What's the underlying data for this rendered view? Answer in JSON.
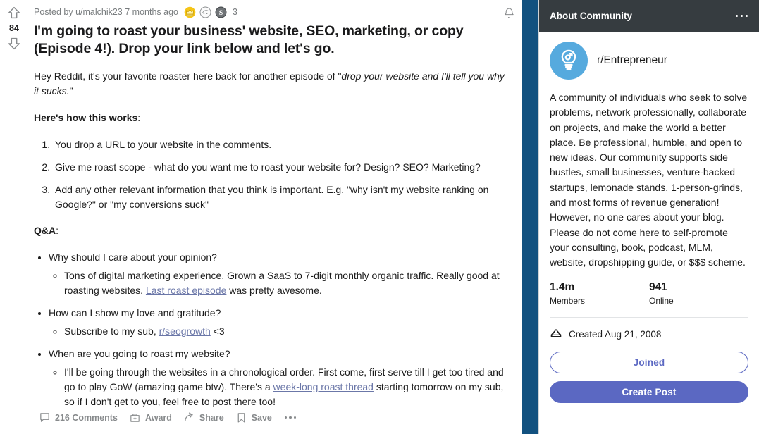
{
  "post": {
    "vote": {
      "score": "84",
      "upvote_icon": "upvote-arrow-icon",
      "downvote_icon": "downvote-arrow-icon"
    },
    "meta": "Posted by u/malchik23 7 months ago",
    "awards": [
      {
        "name": "gold-crown-award-icon"
      },
      {
        "name": "silver-face-award-icon"
      },
      {
        "name": "silver-s-award-icon"
      }
    ],
    "award_count": "3",
    "bell_icon": "notification-bell-icon",
    "title": "I'm going to roast your business' website, SEO, marketing, or copy (Episode 4!). Drop your link below and let's go.",
    "intro_lead": "Hey Reddit, it's your favorite roaster here back for another episode of \"",
    "intro_em": "drop your website and I'll tell you why it sucks.",
    "intro_tail": "\"",
    "how_label": "Here's how this works",
    "how_colon": ":",
    "steps": [
      "You drop a URL to your website in the comments.",
      "Give me roast scope - what do you want me to roast your website for? Design? SEO? Marketing?",
      "Add any other relevant information that you think is important. E.g. \"why isn't my website ranking on Google?\" or \"my conversions suck\""
    ],
    "qa_label": "Q&A",
    "qa_colon": ":",
    "qa": [
      {
        "question": "Why should I care about your opinion?",
        "answer_before": "Tons of digital marketing experience. Grown a SaaS to 7-digit monthly organic traffic. Really good at roasting websites. ",
        "answer_link": "Last roast episode",
        "answer_after": " was pretty awesome."
      },
      {
        "question": "How can I show my love and gratitude?",
        "answer_before": "Subscribe to my sub, ",
        "answer_link": "r/seogrowth",
        "answer_after": " <3"
      },
      {
        "question": "When are you going to roast my website?",
        "answer_before": "I'll be going through the websites in a chronological order. First come, first serve till I get too tired and go to play GoW (amazing game btw). There's a ",
        "answer_link": "week-long roast thread",
        "answer_after": " starting tomorrow on my sub, so if I don't get to you, feel free to post there too!"
      }
    ],
    "actions": {
      "comments": "216 Comments",
      "comments_icon": "comment-bubble-icon",
      "award": "Award",
      "award_icon": "gift-box-icon",
      "share": "Share",
      "share_icon": "share-arrow-icon",
      "save": "Save",
      "save_icon": "bookmark-icon",
      "overflow_icon": "overflow-dots-icon"
    }
  },
  "sidebar": {
    "header_title": "About Community",
    "header_overflow_icon": "overflow-dots-icon",
    "avatar_icon": "lightbulb-community-icon",
    "community_name": "r/Entrepreneur",
    "description": "A community of individuals who seek to solve problems, network professionally, collaborate on projects, and make the world a better place. Be professional, humble, and open to new ideas. Our community supports side hustles, small businesses, venture-backed startups, lemonade stands, 1-person-grinds, and most forms of revenue generation! However, no one cares about your blog. Please do not come here to self-promote your consulting, book, podcast, MLM, website, dropshipping guide, or $$$ scheme.",
    "stats": [
      {
        "value": "1.4m",
        "label": "Members"
      },
      {
        "value": "941",
        "label": "Online"
      }
    ],
    "created_icon": "cake-slice-icon",
    "created": "Created Aug 21, 2008",
    "joined_button": "Joined",
    "create_post_button": "Create Post"
  },
  "colors": {
    "brand_blue": "#5b68c2",
    "band_navy": "#12517f",
    "avatar_blue": "#56aade",
    "link": "#6b77a8",
    "muted": "#878a8c",
    "header_dark": "#363c40"
  }
}
